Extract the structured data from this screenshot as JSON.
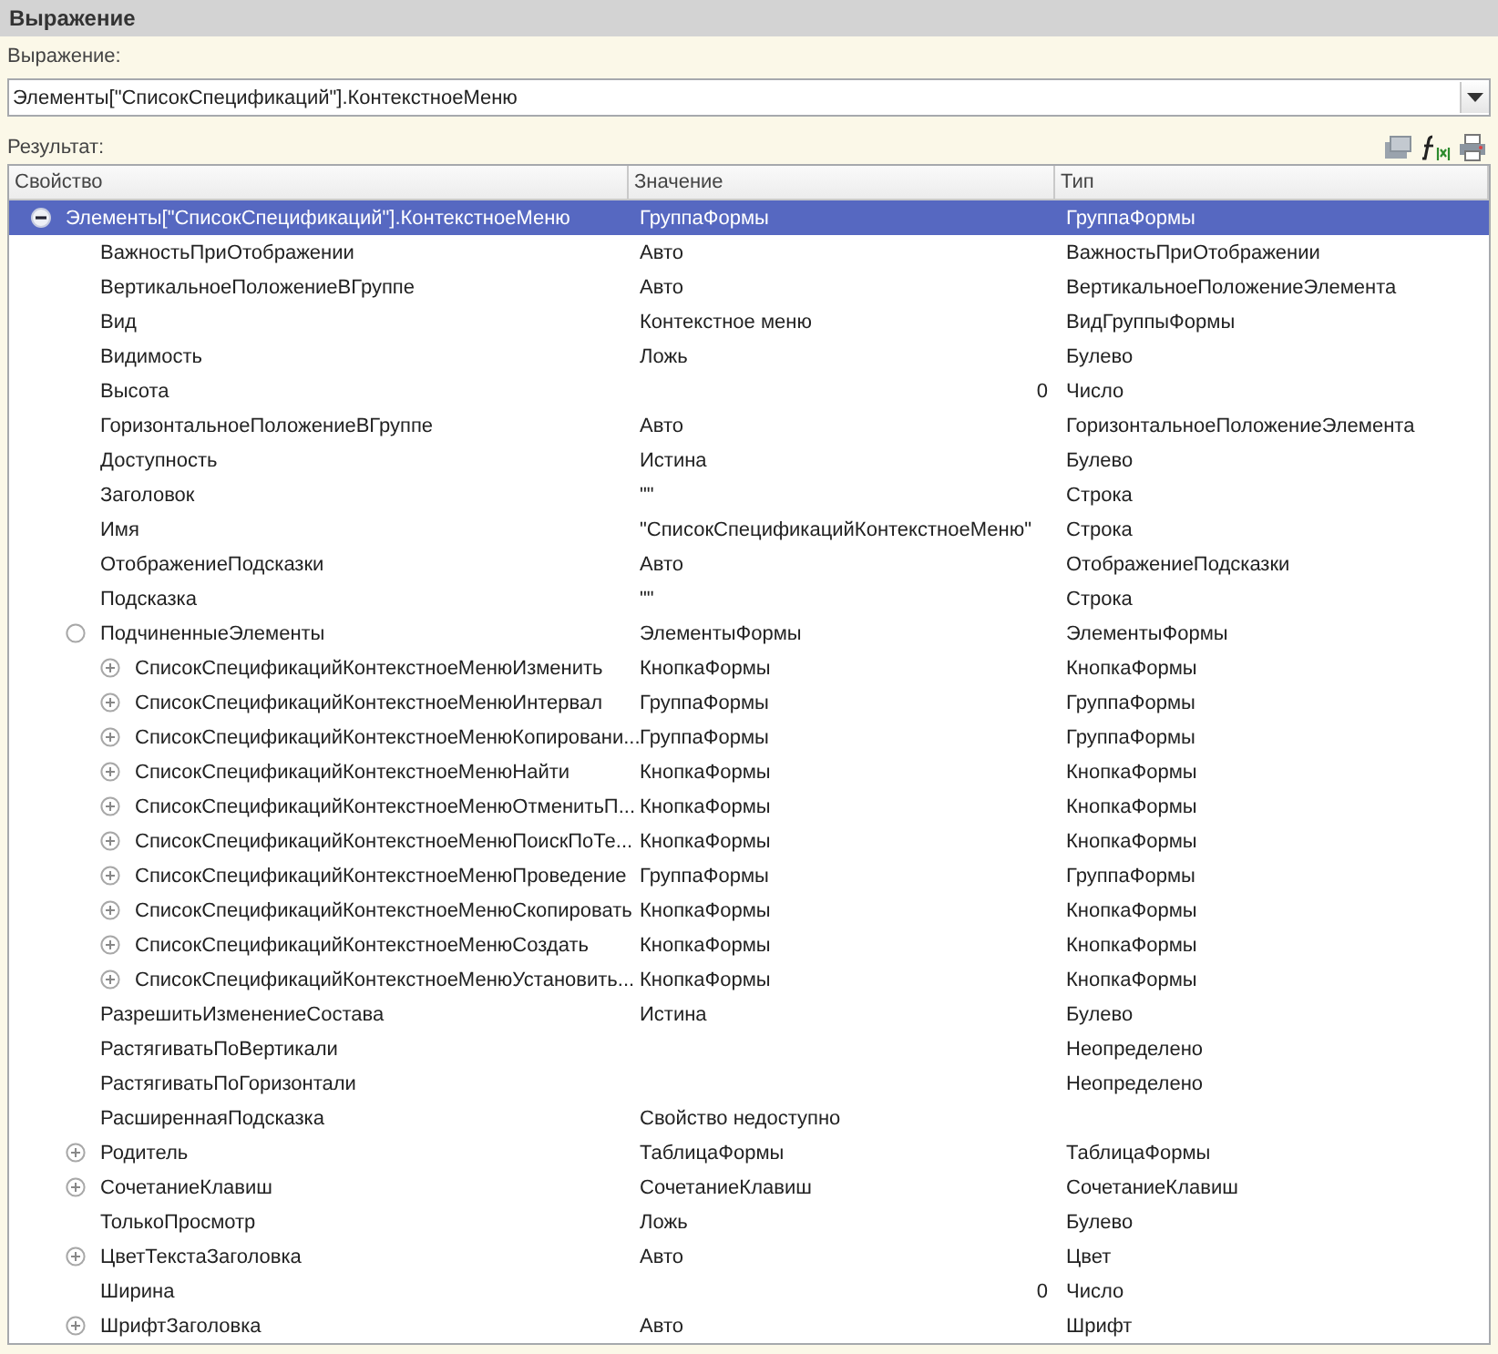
{
  "panel": {
    "title": "Выражение"
  },
  "expression": {
    "label": "Выражение:",
    "value": "Элементы[\"СписокСпецификаций\"].КонтекстноеМеню"
  },
  "result": {
    "label": "Результат:"
  },
  "table": {
    "columns": [
      "Свойство",
      "Значение",
      "Тип"
    ],
    "rows": [
      {
        "property": "Элементы[\"СписокСпецификаций\"].КонтекстноеМеню",
        "value": "ГруппаФормы",
        "type": "ГруппаФормы",
        "kind": "expander",
        "expanded": true,
        "selected": true,
        "children": [
          {
            "property": "ВажностьПриОтображении",
            "value": "Авто",
            "type": "ВажностьПриОтображении",
            "selected": false
          },
          {
            "property": "ВертикальноеПоложениеВГруппе",
            "value": "Авто",
            "type": "ВертикальноеПоложениеЭлемента",
            "selected": false
          },
          {
            "property": "Вид",
            "value": "Контекстное меню",
            "type": "ВидГруппыФормы",
            "selected": false
          },
          {
            "property": "Видимость",
            "value": "Ложь",
            "type": "Булево",
            "selected": false
          },
          {
            "property": "Высота",
            "value": "0",
            "numeric": true,
            "type": "Число",
            "selected": false
          },
          {
            "property": "ГоризонтальноеПоложениеВГруппе",
            "value": "Авто",
            "type": "ГоризонтальноеПоложениеЭлемента",
            "selected": false
          },
          {
            "property": "Доступность",
            "value": "Истина",
            "type": "Булево",
            "selected": false
          },
          {
            "property": "Заголовок",
            "value": "\"\"",
            "type": "Строка",
            "selected": false
          },
          {
            "property": "Имя",
            "value": "\"СписокСпецификацийКонтекстноеМеню\"",
            "type": "Строка",
            "selected": false
          },
          {
            "property": "ОтображениеПодсказки",
            "value": "Авто",
            "type": "ОтображениеПодсказки",
            "selected": false
          },
          {
            "property": "Подсказка",
            "value": "\"\"",
            "type": "Строка",
            "selected": false
          },
          {
            "property": "ПодчиненныеЭлементы",
            "value": "ЭлементыФормы",
            "type": "ЭлементыФормы",
            "kind": "circle",
            "expanded": true,
            "selected": false,
            "children": [
              {
                "property": "СписокСпецификацийКонтекстноеМенюИзменить",
                "value": "КнопкаФормы",
                "type": "КнопкаФормы",
                "kind": "expander",
                "expanded": false,
                "selected": false
              },
              {
                "property": "СписокСпецификацийКонтекстноеМенюИнтервал",
                "value": "ГруппаФормы",
                "type": "ГруппаФормы",
                "kind": "expander",
                "expanded": false,
                "selected": false
              },
              {
                "property": "СписокСпецификацийКонтекстноеМенюКопировани...",
                "value": "ГруппаФормы",
                "type": "ГруппаФормы",
                "kind": "expander",
                "expanded": false,
                "selected": false
              },
              {
                "property": "СписокСпецификацийКонтекстноеМенюНайти",
                "value": "КнопкаФормы",
                "type": "КнопкаФормы",
                "kind": "expander",
                "expanded": false,
                "selected": false
              },
              {
                "property": "СписокСпецификацийКонтекстноеМенюОтменитьП...",
                "value": "КнопкаФормы",
                "type": "КнопкаФормы",
                "kind": "expander",
                "expanded": false,
                "selected": false
              },
              {
                "property": "СписокСпецификацийКонтекстноеМенюПоискПоТе...",
                "value": "КнопкаФормы",
                "type": "КнопкаФормы",
                "kind": "expander",
                "expanded": false,
                "selected": false
              },
              {
                "property": "СписокСпецификацийКонтекстноеМенюПроведение",
                "value": "ГруппаФормы",
                "type": "ГруппаФормы",
                "kind": "expander",
                "expanded": false,
                "selected": false
              },
              {
                "property": "СписокСпецификацийКонтекстноеМенюСкопировать",
                "value": "КнопкаФормы",
                "type": "КнопкаФормы",
                "kind": "expander",
                "expanded": false,
                "selected": false
              },
              {
                "property": "СписокСпецификацийКонтекстноеМенюСоздать",
                "value": "КнопкаФормы",
                "type": "КнопкаФормы",
                "kind": "expander",
                "expanded": false,
                "selected": false
              },
              {
                "property": "СписокСпецификацийКонтекстноеМенюУстановить...",
                "value": "КнопкаФормы",
                "type": "КнопкаФормы",
                "kind": "expander",
                "expanded": false,
                "selected": false
              }
            ]
          },
          {
            "property": "РазрешитьИзменениеСостава",
            "value": "Истина",
            "type": "Булево",
            "selected": false
          },
          {
            "property": "РастягиватьПоВертикали",
            "type": "Неопределено",
            "selected": false
          },
          {
            "property": "РастягиватьПоГоризонтали",
            "type": "Неопределено",
            "selected": false
          },
          {
            "property": "РасширеннаяПодсказка",
            "value": "Свойство недоступно",
            "selected": false
          },
          {
            "property": "Родитель",
            "value": "ТаблицаФормы",
            "type": "ТаблицаФормы",
            "kind": "expander",
            "expanded": false,
            "selected": false
          },
          {
            "property": "СочетаниеКлавиш",
            "value": "СочетаниеКлавиш",
            "type": "СочетаниеКлавиш",
            "kind": "expander",
            "expanded": false,
            "selected": false
          },
          {
            "property": "ТолькоПросмотр",
            "value": "Ложь",
            "type": "Булево",
            "selected": false
          },
          {
            "property": "ЦветТекстаЗаголовка",
            "value": "Авто",
            "type": "Цвет",
            "kind": "expander",
            "expanded": false,
            "selected": false
          },
          {
            "property": "Ширина",
            "value": "0",
            "numeric": true,
            "type": "Число",
            "selected": false
          },
          {
            "property": "ШрифтЗаголовка",
            "value": "Авто",
            "type": "Шрифт",
            "kind": "expander",
            "expanded": false,
            "selected": false
          }
        ]
      }
    ]
  }
}
